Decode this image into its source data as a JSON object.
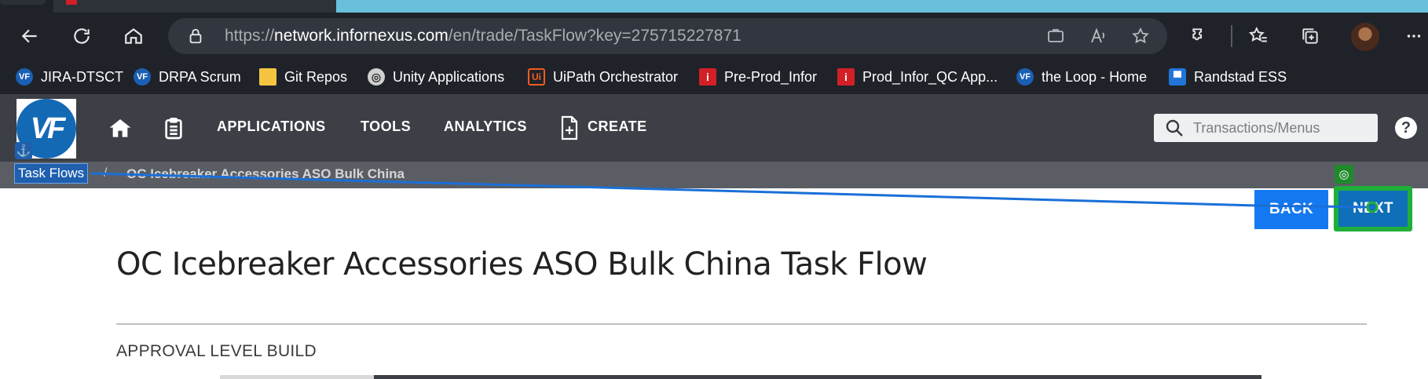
{
  "browser": {
    "url_scheme": "https://",
    "url_host": "network.infornexus.com",
    "url_path": "/en/trade/TaskFlow?key=275715227871"
  },
  "bookmarks": [
    {
      "label": "JIRA-DTSCT",
      "icon": "vf-icon"
    },
    {
      "label": "DRPA Scrum",
      "icon": "vf-icon"
    },
    {
      "label": "Git Repos",
      "icon": "folder-icon"
    },
    {
      "label": "Unity Applications",
      "icon": "unity-icon"
    },
    {
      "label": "UiPath Orchestrator",
      "icon": "uipath-icon"
    },
    {
      "label": "Pre-Prod_Infor",
      "icon": "infor-icon"
    },
    {
      "label": "Prod_Infor_QC App...",
      "icon": "infor-icon"
    },
    {
      "label": "the Loop - Home",
      "icon": "vf-icon"
    },
    {
      "label": "Randstad ESS",
      "icon": "randstad-icon"
    }
  ],
  "app_nav": {
    "applications": "APPLICATIONS",
    "tools": "TOOLS",
    "analytics": "ANALYTICS",
    "create": "CREATE",
    "search_placeholder": "Transactions/Menus",
    "help": "?"
  },
  "breadcrumb": {
    "parent": "Task Flows",
    "separator": "/",
    "current": "OC Icebreaker Accessories ASO Bulk China"
  },
  "actions": {
    "back": "BACK",
    "next": "NEXT"
  },
  "page": {
    "title": "OC Icebreaker Accessories ASO Bulk China Task Flow",
    "section": "APPROVAL LEVEL BUILD"
  },
  "colors": {
    "browser_chrome": "#1f2329",
    "app_header": "#3c3f45",
    "back_button": "#1479f0",
    "next_button": "#0f6fb8",
    "highlight_green": "#1fae3a",
    "highlight_blue": "#1f5fae"
  }
}
